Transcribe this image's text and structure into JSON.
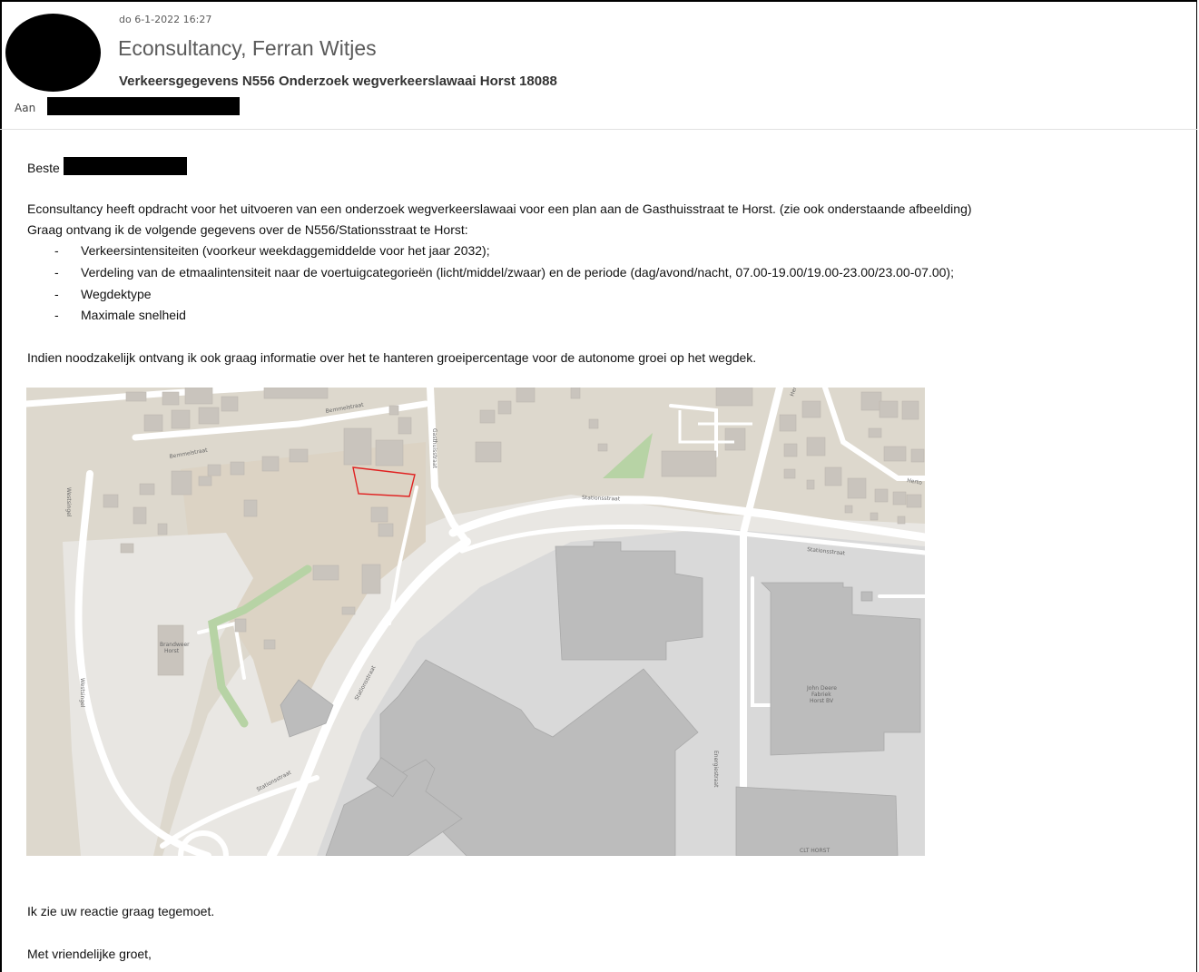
{
  "email": {
    "date": "do 6-1-2022 16:27",
    "sender": "Econsultancy, Ferran Witjes",
    "subject": "Verkeersgegevens N556 Onderzoek wegverkeerslawaai Horst 18088",
    "to_label": "Aan"
  },
  "body": {
    "greeting": "Beste",
    "intro1": "Econsultancy heeft opdracht voor het uitvoeren van een onderzoek wegverkeerslawaai voor een plan aan de Gasthuisstraat te Horst. (zie ook onderstaande afbeelding)",
    "intro2": "Graag ontvang ik de volgende gegevens over de N556/Stationsstraat te Horst:",
    "bullets": [
      "Verkeersintensiteiten (voorkeur weekdaggemiddelde voor het jaar 2032);",
      "Verdeling van de etmaalintensiteit naar de voertuigcategorieën (licht/middel/zwaar) en de periode (dag/avond/nacht, 07.00-19.00/19.00-23.00/23.00-07.00);",
      "Wegdektype",
      "Maximale snelheid"
    ],
    "dash": "-",
    "paragraph2": "Indien noodzakelijk ontvang ik ook graag informatie over het te hanteren groeipercentage voor de autonome groei op het wegdek.",
    "closing1": "Ik zie uw reactie graag tegemoet.",
    "closing2": "Met vriendelijke groet,"
  },
  "map": {
    "labels": {
      "bemmelstraat1": "Bemmelstraat",
      "bemmelstraat2": "Bemmelstraat",
      "gasthuisstraat": "Gasthuisstraat",
      "stationsstraat1": "Stationsstraat",
      "stationsstraat2": "Stationsstraat",
      "stationsstraat3": "Stationsstraat",
      "stationsstraat4": "Stationsstraat",
      "westsingel1": "Westsingel",
      "westsingel2": "Westsingel",
      "energiestraat": "Energiestraat",
      "herto1": "Herto",
      "herto2": "Herto",
      "brandweer1": "Brandweer",
      "brandweer2": "Horst",
      "johndeere1": "John Deere",
      "johndeere2": "Fabriek",
      "johndeere3": "Horst BV",
      "clt": "CLT HORST"
    },
    "colors": {
      "residential": "#ddd8cd",
      "industrial": "#d9d9d9",
      "building": "#c9c4bd",
      "building_industrial": "#bcbcbc",
      "road": "#ffffff",
      "green": "#b7d3a5",
      "plot_outline": "#e02020"
    }
  }
}
